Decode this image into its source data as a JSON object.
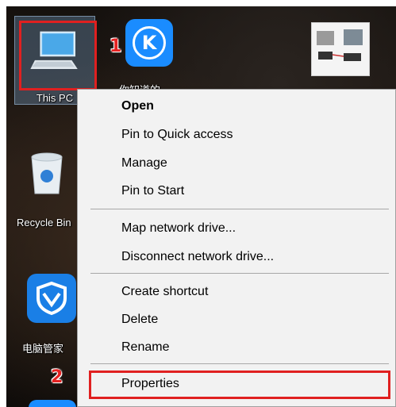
{
  "desktop": {
    "icons": {
      "this_pc": {
        "label": "This PC"
      },
      "k_app": {
        "label": "你知道的",
        "glyph": "K"
      },
      "recycle_bin": {
        "label": "Recycle Bin"
      },
      "pc_manager": {
        "label": "电脑管家"
      }
    }
  },
  "annotations": {
    "step1": "1",
    "step2": "2",
    "highlight_color": "#e02020"
  },
  "context_menu": {
    "items": [
      {
        "label": "Open",
        "bold": true
      },
      {
        "label": "Pin to Quick access"
      },
      {
        "label": "Manage"
      },
      {
        "label": "Pin to Start"
      },
      {
        "label": "Map network drive..."
      },
      {
        "label": "Disconnect network drive..."
      },
      {
        "label": "Create shortcut"
      },
      {
        "label": "Delete"
      },
      {
        "label": "Rename"
      },
      {
        "label": "Properties"
      }
    ]
  }
}
